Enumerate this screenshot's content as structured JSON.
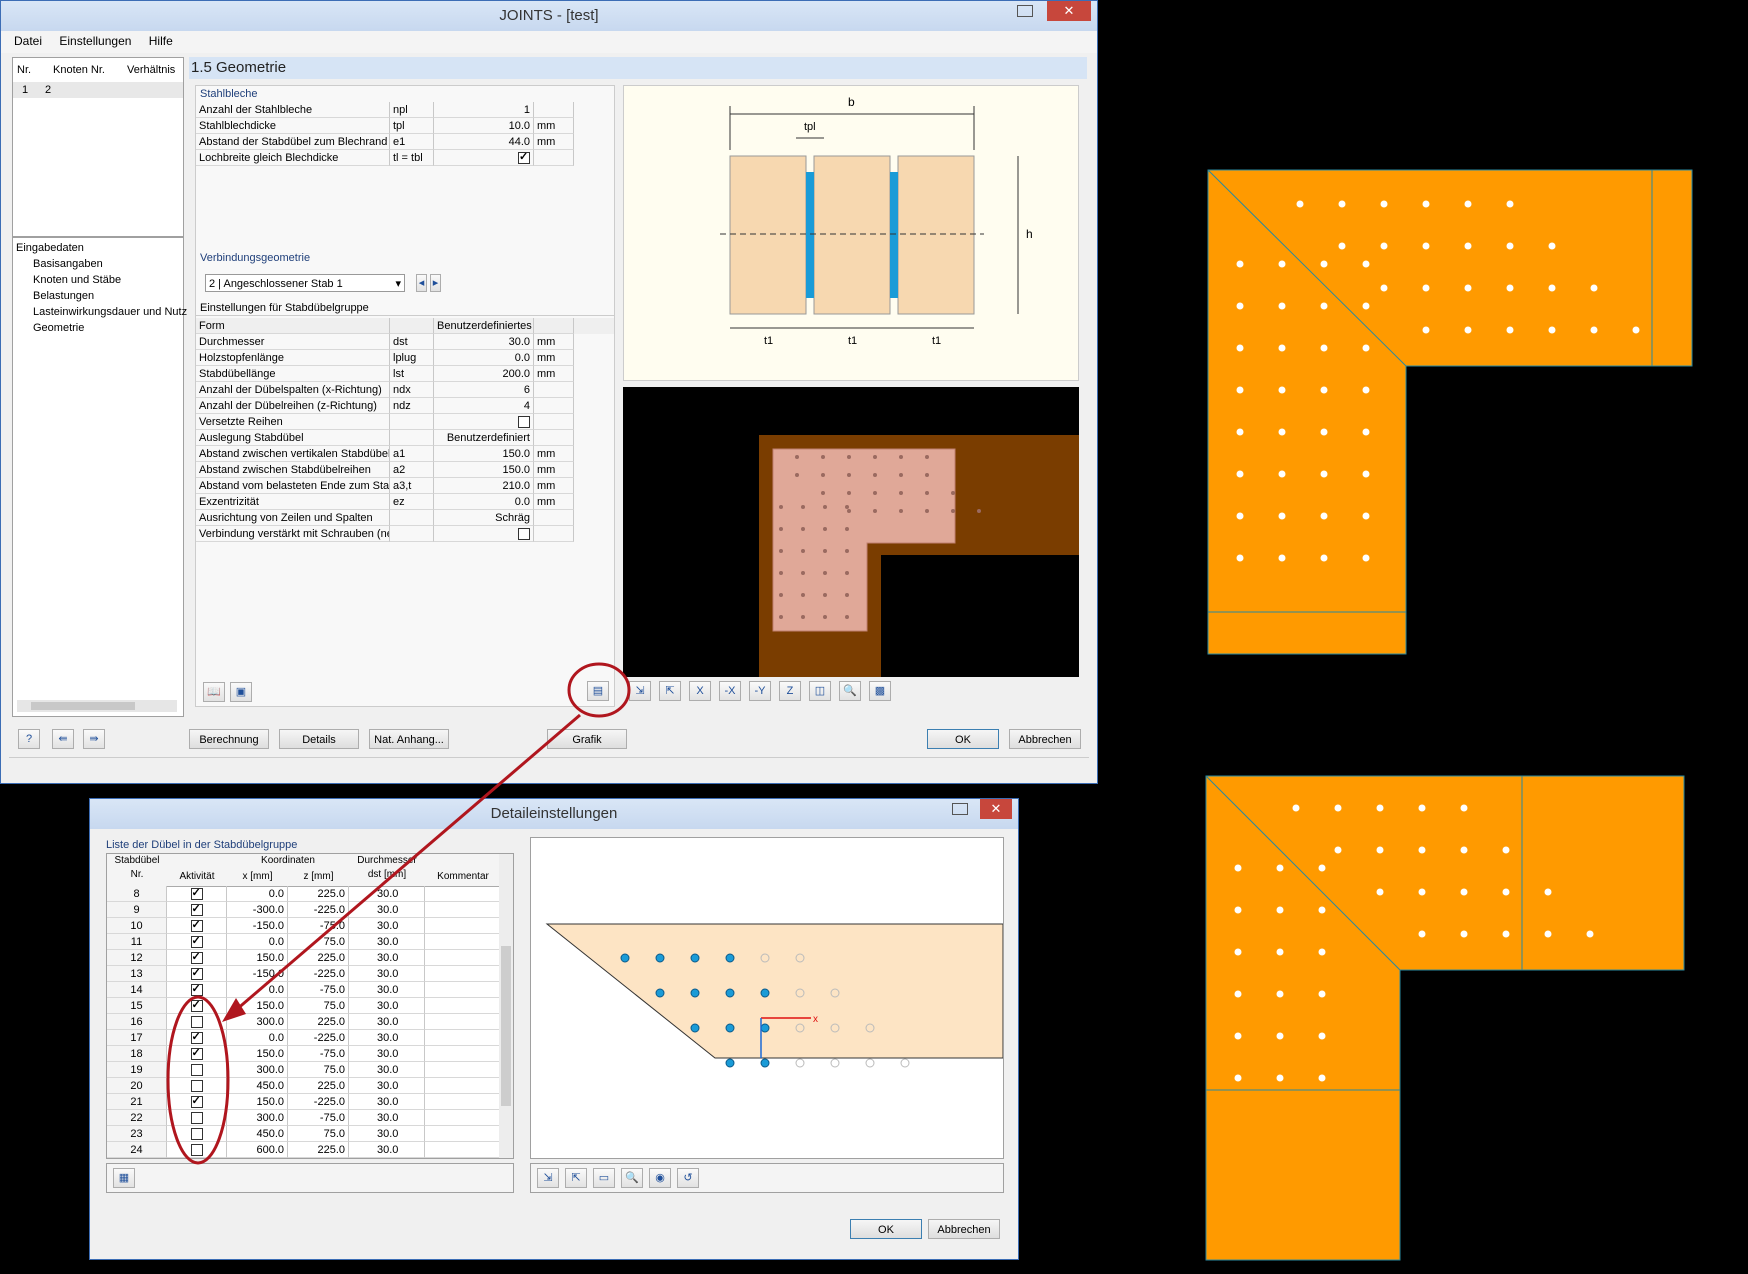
{
  "main_window": {
    "title": "JOINTS - [test]",
    "close_glyph": "✕",
    "menu": [
      "Datei",
      "Einstellungen",
      "Hilfe"
    ],
    "case_list": {
      "headers": [
        "Nr.",
        "Knoten Nr.",
        "Verhältnis"
      ],
      "rows": [
        [
          "1",
          "2",
          ""
        ]
      ]
    },
    "nav": {
      "root": "Eingabedaten",
      "items": [
        "Basisangaben",
        "Knoten und Stäbe",
        "Belastungen",
        "Lasteinwirkungsdauer und Nutz",
        "Geometrie"
      ]
    },
    "section_title": "1.5 Geometrie",
    "stahlbleche": {
      "label": "Stahlbleche",
      "rows": [
        {
          "name": "Anzahl der Stahlbleche",
          "sym": "npl",
          "value": "1",
          "unit": ""
        },
        {
          "name": "Stahlblechdicke",
          "sym": "tpl",
          "value": "10.0",
          "unit": "mm"
        },
        {
          "name": "Abstand der Stabdübel zum Blechrand",
          "sym": "e1",
          "value": "44.0",
          "unit": "mm"
        },
        {
          "name": "Lochbreite gleich Blechdicke",
          "sym": "tl = tbl",
          "value": "",
          "unit": "",
          "checkbox": true
        }
      ]
    },
    "verbindung": {
      "label": "Verbindungsgeometrie",
      "select": "2 | Angeschlossener Stab 1",
      "header": "Einstellungen für  Stabdübelgruppe",
      "rows": [
        {
          "name": "Form",
          "sym": "",
          "value": "Benutzerdefiniertes",
          "unit": "",
          "shade": true
        },
        {
          "name": "Durchmesser",
          "sym": "dst",
          "value": "30.0",
          "unit": "mm"
        },
        {
          "name": "Holzstopfenlänge",
          "sym": "lplug",
          "value": "0.0",
          "unit": "mm"
        },
        {
          "name": "Stabdübellänge",
          "sym": "lst",
          "value": "200.0",
          "unit": "mm"
        },
        {
          "name": "Anzahl der Dübelspalten (x-Richtung)",
          "sym": "ndx",
          "value": "6",
          "unit": ""
        },
        {
          "name": "Anzahl der Dübelreihen (z-Richtung)",
          "sym": "ndz",
          "value": "4",
          "unit": ""
        },
        {
          "name": "Versetzte Reihen",
          "sym": "",
          "value": "",
          "unit": "",
          "checkbox": false
        },
        {
          "name": "Auslegung Stabdübel",
          "sym": "",
          "value": "Benutzerdefiniert",
          "unit": ""
        },
        {
          "name": "Abstand zwischen vertikalen Stabdübelreihe",
          "sym": "a1",
          "value": "150.0",
          "unit": "mm"
        },
        {
          "name": "Abstand zwischen Stabdübelreihen",
          "sym": "a2",
          "value": "150.0",
          "unit": "mm"
        },
        {
          "name": "Abstand vom belasteten Ende zum Stabdüb",
          "sym": "a3,t",
          "value": "210.0",
          "unit": "mm"
        },
        {
          "name": "Exzentrizität",
          "sym": "ez",
          "value": "0.0",
          "unit": "mm"
        },
        {
          "name": "Ausrichtung von Zeilen und Spalten",
          "sym": "",
          "value": "Schräg",
          "unit": ""
        },
        {
          "name": "Verbindung verstärkt mit Schrauben (nef = r",
          "sym": "",
          "value": "",
          "unit": "",
          "checkbox": false
        }
      ]
    },
    "drawing_labels": {
      "b": "b",
      "tpl": "tpl",
      "h": "h",
      "t1": "t1"
    },
    "buttons": [
      "Berechnung",
      "Details",
      "Nat. Anhang...",
      "Grafik",
      "OK",
      "Abbrechen"
    ]
  },
  "detail_window": {
    "title": "Detaileinstellungen",
    "close_glyph": "✕",
    "group_label": "Liste der Dübel in der Stabdübelgruppe",
    "headers": {
      "col1": [
        "Stabdübel",
        "Nr."
      ],
      "col2": "Aktivität",
      "coords": "Koordinaten",
      "x": "x [mm]",
      "z": "z [mm]",
      "diam": [
        "Durchmesser",
        "dst [mm]"
      ],
      "comment": "Kommentar"
    },
    "rows": [
      {
        "nr": "8",
        "active": true,
        "x": "0.0",
        "z": "225.0",
        "d": "30.0"
      },
      {
        "nr": "9",
        "active": true,
        "x": "-300.0",
        "z": "-225.0",
        "d": "30.0"
      },
      {
        "nr": "10",
        "active": true,
        "x": "-150.0",
        "z": "-75.0",
        "d": "30.0"
      },
      {
        "nr": "11",
        "active": true,
        "x": "0.0",
        "z": "75.0",
        "d": "30.0"
      },
      {
        "nr": "12",
        "active": true,
        "x": "150.0",
        "z": "225.0",
        "d": "30.0"
      },
      {
        "nr": "13",
        "active": true,
        "x": "-150.0",
        "z": "-225.0",
        "d": "30.0"
      },
      {
        "nr": "14",
        "active": true,
        "x": "0.0",
        "z": "-75.0",
        "d": "30.0"
      },
      {
        "nr": "15",
        "active": true,
        "x": "150.0",
        "z": "75.0",
        "d": "30.0"
      },
      {
        "nr": "16",
        "active": false,
        "x": "300.0",
        "z": "225.0",
        "d": "30.0"
      },
      {
        "nr": "17",
        "active": true,
        "x": "0.0",
        "z": "-225.0",
        "d": "30.0"
      },
      {
        "nr": "18",
        "active": true,
        "x": "150.0",
        "z": "-75.0",
        "d": "30.0"
      },
      {
        "nr": "19",
        "active": false,
        "x": "300.0",
        "z": "75.0",
        "d": "30.0"
      },
      {
        "nr": "20",
        "active": false,
        "x": "450.0",
        "z": "225.0",
        "d": "30.0"
      },
      {
        "nr": "21",
        "active": true,
        "x": "150.0",
        "z": "-225.0",
        "d": "30.0"
      },
      {
        "nr": "22",
        "active": false,
        "x": "300.0",
        "z": "-75.0",
        "d": "30.0"
      },
      {
        "nr": "23",
        "active": false,
        "x": "450.0",
        "z": "75.0",
        "d": "30.0"
      },
      {
        "nr": "24",
        "active": false,
        "x": "600.0",
        "z": "225.0",
        "d": "30.0"
      }
    ],
    "axis_label": "x",
    "buttons": [
      "OK",
      "Abbrechen"
    ]
  },
  "colors": {
    "accent": "#3c6db5",
    "highlight_red": "#b0161e",
    "plate": "#ff9a00",
    "wood": "#f7d8b0",
    "steel": "#1a9bd7"
  }
}
